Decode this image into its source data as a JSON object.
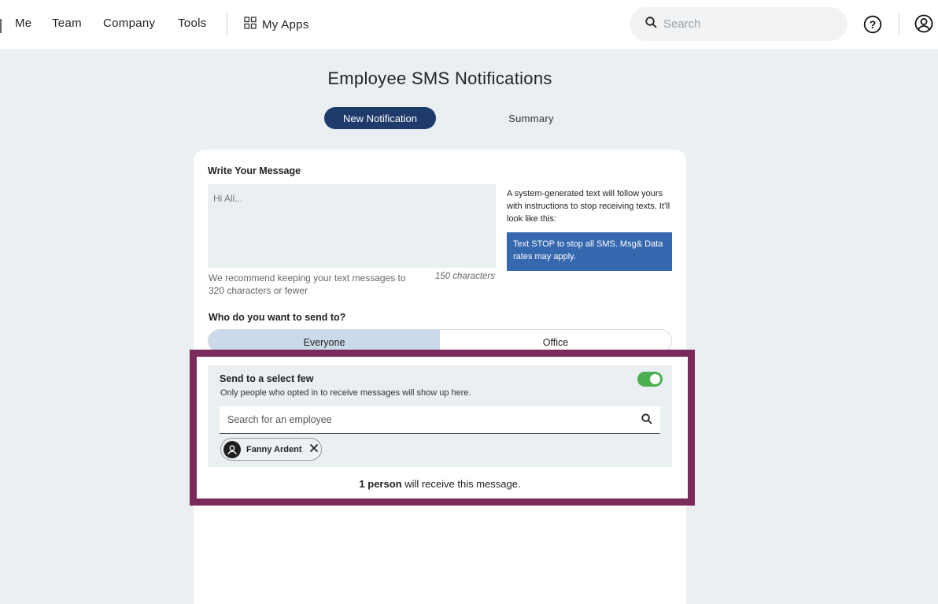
{
  "nav": {
    "links": [
      "Me",
      "Team",
      "Company",
      "Tools"
    ],
    "my_apps": "My Apps",
    "search_placeholder": "Search"
  },
  "page": {
    "title": "Employee SMS Notifications",
    "tabs": [
      {
        "label": "New Notification",
        "active": true
      },
      {
        "label": "Summary",
        "active": false
      }
    ]
  },
  "message": {
    "label": "Write Your Message",
    "placeholder": "Hi All...",
    "recommend": "We recommend keeping your text messages to 320 characters or fewer",
    "char_count": "150 characters",
    "system_note": "A system-generated text will follow yours with instructions to stop receiving texts. It’ll look like this:",
    "stop_text": "Text STOP to stop all SMS. Msg& Data rates may apply."
  },
  "audience": {
    "label": "Who do you want to send to?",
    "options": [
      {
        "label": "Everyone",
        "selected": true
      },
      {
        "label": "Office",
        "selected": false
      }
    ]
  },
  "select_few": {
    "title": "Send to a select few",
    "subtitle": "Only people who opted in to receive messages will show up here.",
    "toggle_on": true,
    "search_placeholder": "Search for an employee",
    "selected_employees": [
      "Fanny Ardent"
    ],
    "receive_count": "1 person",
    "receive_suffix": " will receive this message."
  },
  "colors": {
    "primary": "#1f3b6b",
    "stop_box": "#3668b0",
    "toggle": "#4caf50",
    "highlight_frame": "#7a2b5c",
    "background": "#eaeff2"
  }
}
